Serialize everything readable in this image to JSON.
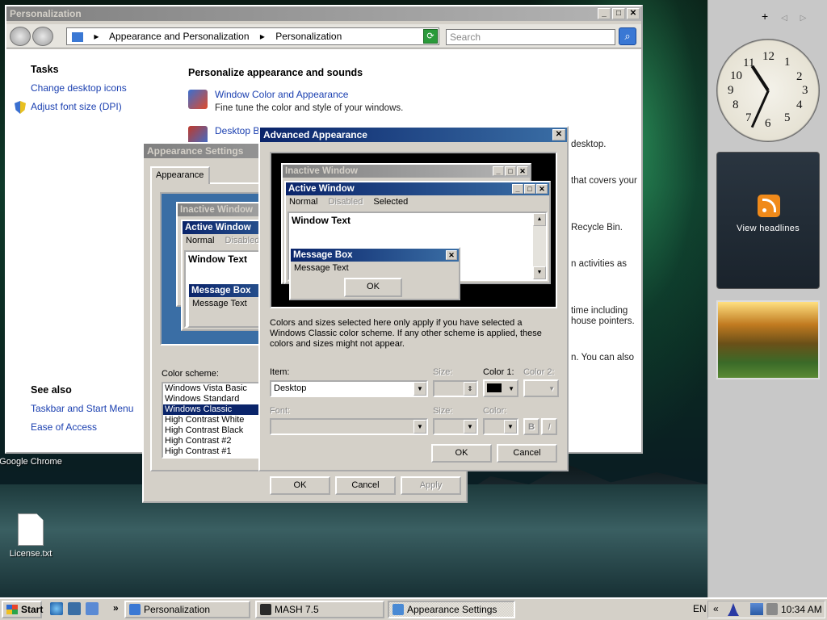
{
  "desktop": {
    "icons": [
      {
        "label": "Google Chrome"
      },
      {
        "label": "License.txt"
      }
    ]
  },
  "sidebar": {
    "add_glyph": "+",
    "prev_glyph": "◁",
    "next_glyph": "▷",
    "feed_label": "View headlines",
    "clock_numbers": [
      "12",
      "1",
      "2",
      "3",
      "4",
      "5",
      "6",
      "7",
      "8",
      "9",
      "10",
      "11"
    ]
  },
  "personalization": {
    "title": "Personalization",
    "crumbs": [
      "Appearance and Personalization",
      "Personalization"
    ],
    "search_placeholder": "Search",
    "tasks_heading": "Tasks",
    "tasks": [
      "Change desktop icons",
      "Adjust font size (DPI)"
    ],
    "see_also_heading": "See also",
    "see_also": [
      "Taskbar and Start Menu",
      "Ease of Access"
    ],
    "main_heading": "Personalize appearance and sounds",
    "items": [
      {
        "link": "Window Color and Appearance",
        "desc": "Fine tune the color and style of your windows."
      },
      {
        "link": "Desktop Ba",
        "desc": ""
      }
    ],
    "partial_texts": [
      "desktop.",
      "that covers your",
      "Recycle Bin.",
      "n activities as",
      "time including",
      "house pointers.",
      "n. You can also"
    ]
  },
  "appearance_settings": {
    "title": "Appearance Settings",
    "tab": "Appearance",
    "preview": {
      "inactive": "Inactive Window",
      "active": "Active Window",
      "normal": "Normal",
      "disabled": "Disabled",
      "window_text": "Window Text",
      "message_box": "Message Box",
      "message_text": "Message Text"
    },
    "color_scheme_label": "Color scheme:",
    "schemes": [
      "Windows Vista Basic",
      "Windows Standard",
      "Windows Classic",
      "High Contrast White",
      "High Contrast Black",
      "High Contrast #2",
      "High Contrast #1"
    ],
    "selected_scheme": "Windows Classic",
    "ok": "OK",
    "cancel": "Cancel",
    "apply": "Apply"
  },
  "advanced": {
    "title": "Advanced Appearance",
    "preview": {
      "inactive": "Inactive Window",
      "active": "Active Window",
      "normal": "Normal",
      "disabled": "Disabled",
      "selected": "Selected",
      "window_text": "Window Text",
      "message_box": "Message Box",
      "message_text": "Message Text",
      "ok": "OK"
    },
    "note": "Colors and sizes selected here only apply if you have selected a Windows Classic color scheme. If any other scheme is applied, these colors and sizes might not appear.",
    "item_label": "Item:",
    "item_value": "Desktop",
    "size_label": "Size:",
    "color1_label": "Color 1:",
    "color2_label": "Color 2:",
    "color1_value": "#000000",
    "font_label": "Font:",
    "font_size_label": "Size:",
    "font_color_label": "Color:",
    "bold": "B",
    "italic": "I",
    "ok": "OK",
    "cancel": "Cancel"
  },
  "taskbar": {
    "start": "Start",
    "overflow": "»",
    "buttons": [
      "Personalization",
      "MASH 7.5",
      "Appearance Settings"
    ],
    "active": "Appearance Settings",
    "lang": "EN",
    "tray_expand": "«",
    "time": "10:34 AM"
  },
  "colors": {
    "title_active": "#0a246a",
    "title_active_end": "#3a6ea5",
    "link": "#1a3fb0",
    "face": "#d4d0c8"
  }
}
